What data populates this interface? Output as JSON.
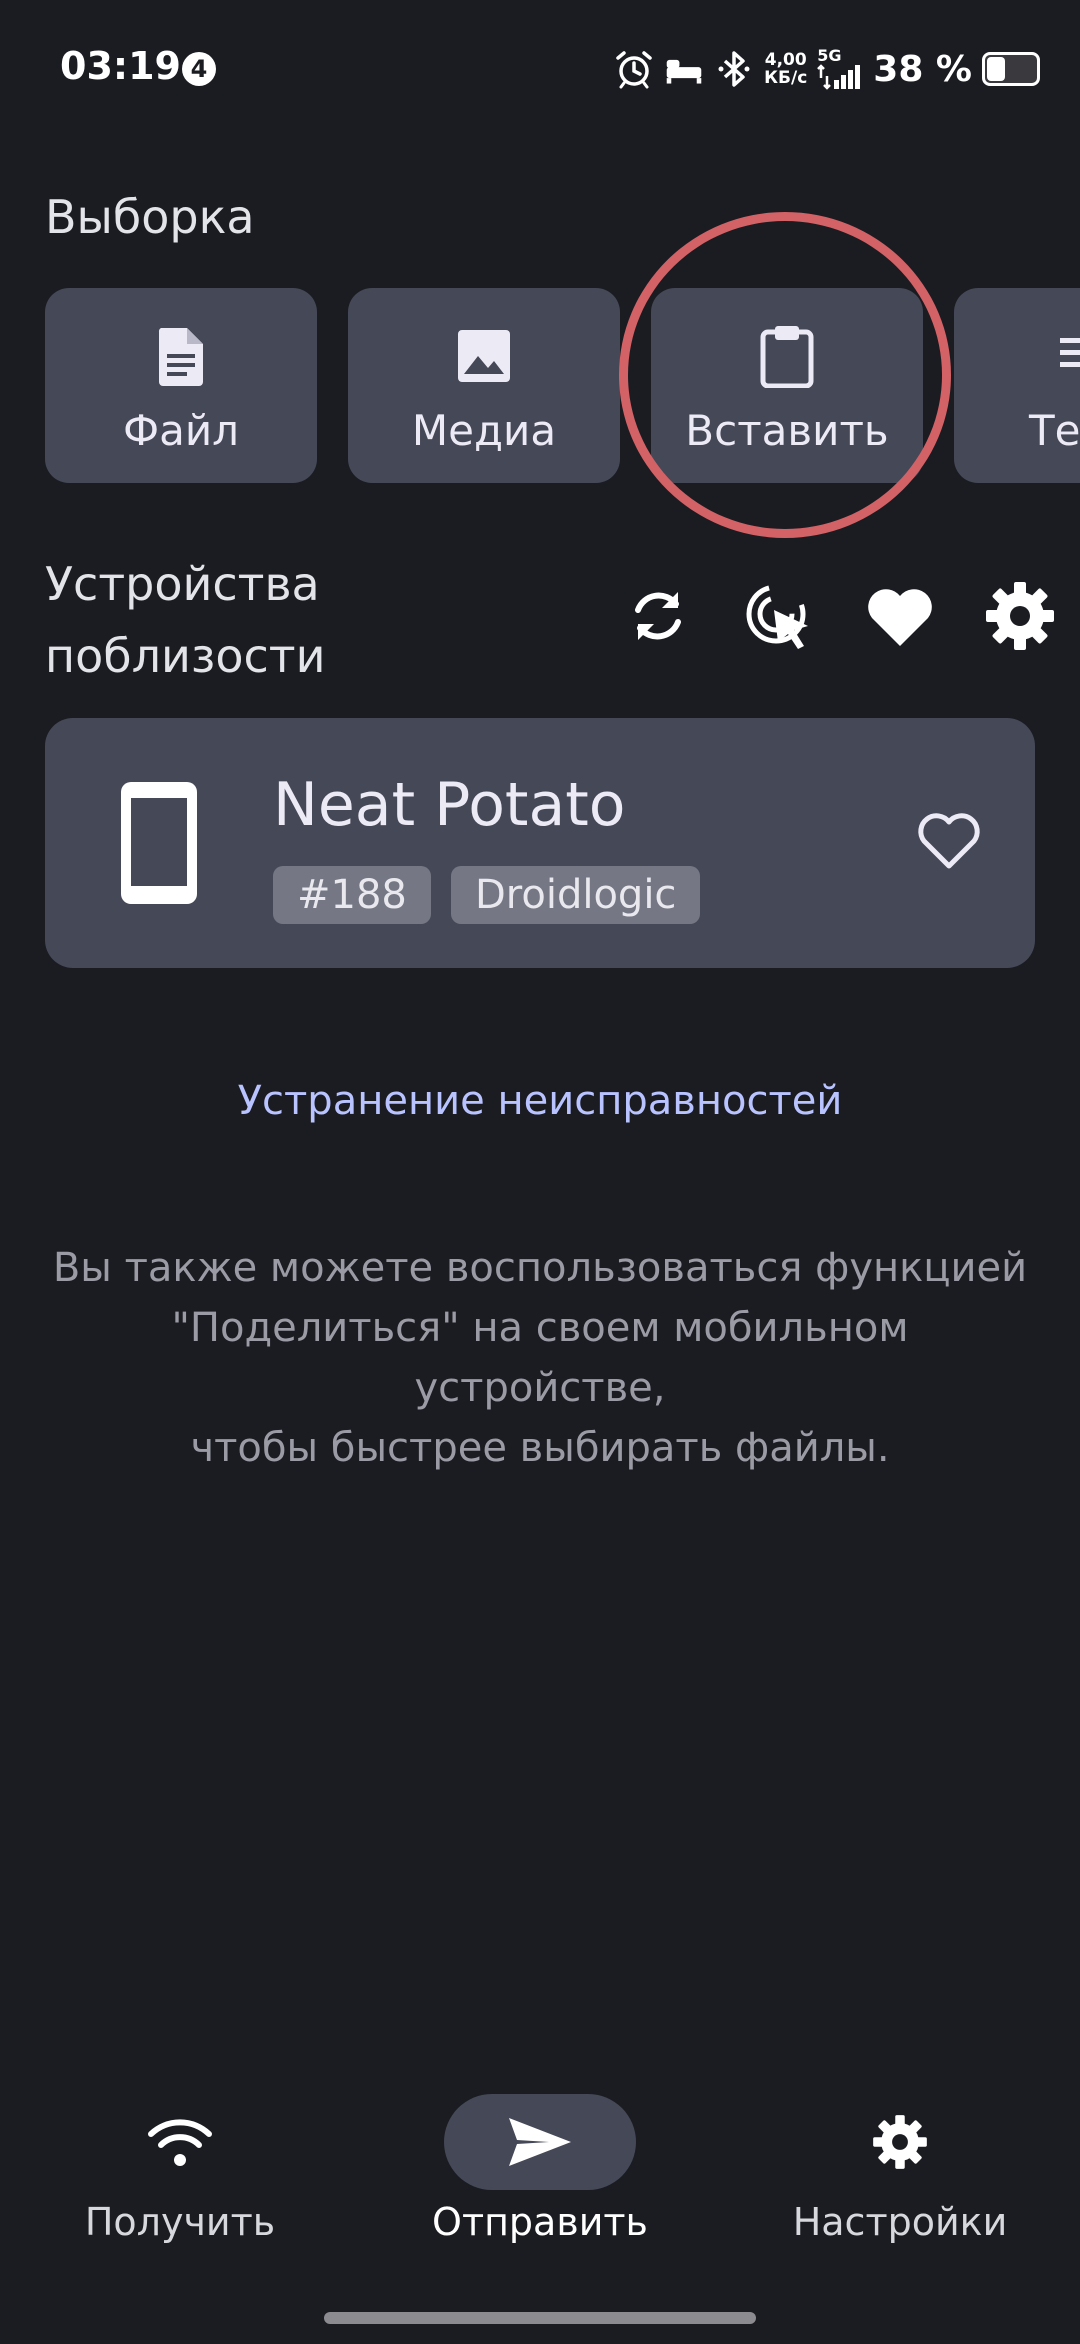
{
  "status_bar": {
    "time": "03:19",
    "notification_count": "4",
    "speed_value": "4,00",
    "speed_unit": "КБ/с",
    "network_type": "5G",
    "battery_percent": "38 %",
    "icons": [
      "alarm-icon",
      "sleep-icon",
      "bluetooth-icon",
      "signal-icon",
      "battery-icon"
    ],
    "battery_level": 0.38
  },
  "selection": {
    "title": "Выборка",
    "chips": [
      {
        "label": "Файл",
        "icon": "file-icon"
      },
      {
        "label": "Медиа",
        "icon": "image-icon"
      },
      {
        "label": "Вставить",
        "icon": "clipboard-icon"
      },
      {
        "label": "Те",
        "icon": "text-icon"
      }
    ]
  },
  "nearby": {
    "title_line1": "Устройства",
    "title_line2": "поблизости",
    "actions": [
      "refresh-icon",
      "scan-target-icon",
      "favorites-heart-icon",
      "gear-icon"
    ]
  },
  "device": {
    "name": "Neat Potato",
    "tag_id": "#188",
    "tag_model": "Droidlogic",
    "icon": "phone-icon",
    "favorite_icon": "heart-outline-icon"
  },
  "troubleshoot_label": "Устранение неисправностей",
  "hint": {
    "line1": "Вы также можете воспользоваться функцией",
    "line2": "\"Поделиться\" на своем мобильном устройстве,",
    "line3": "чтобы быстрее выбирать файлы."
  },
  "bottom_nav": {
    "items": [
      {
        "label": "Получить",
        "icon": "wifi-icon",
        "active": false
      },
      {
        "label": "Отправить",
        "icon": "send-icon",
        "active": true
      },
      {
        "label": "Настройки",
        "icon": "gear-icon",
        "active": false
      }
    ]
  },
  "colors": {
    "background": "#1b1c22",
    "card": "#454857",
    "accent_link": "#b8c3ff",
    "highlight_ring": "#d26266"
  }
}
